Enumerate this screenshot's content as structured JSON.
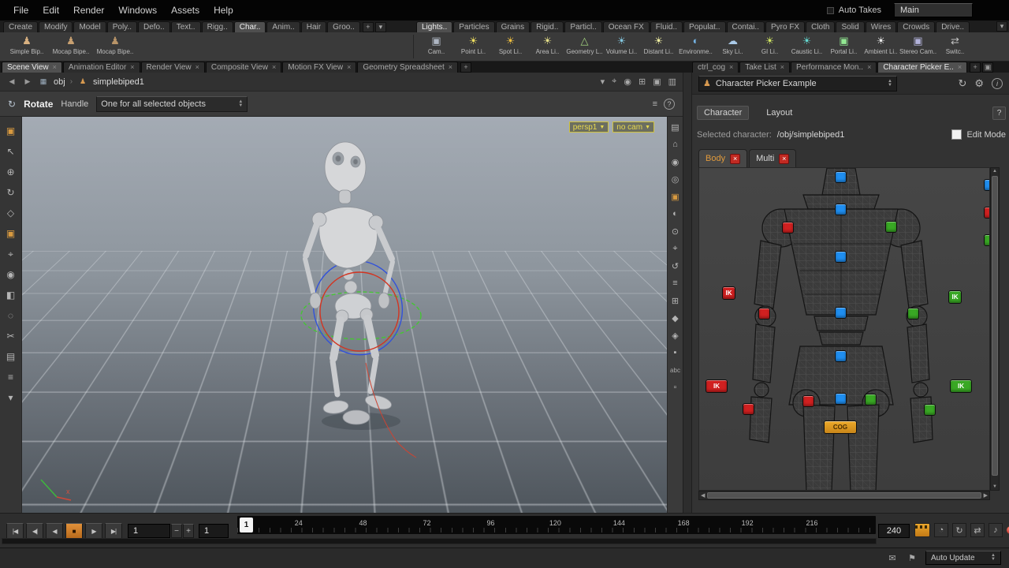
{
  "menubar": {
    "items": [
      "File",
      "Edit",
      "Render",
      "Windows",
      "Assets",
      "Help"
    ],
    "auto_takes": "Auto Takes",
    "take": "Main"
  },
  "shelf": {
    "tabs_left": [
      "Create",
      "Modify",
      "Model",
      "Poly..",
      "Defo..",
      "Text..",
      "Rigg..",
      "Char..",
      "Anim..",
      "Hair",
      "Groo.."
    ],
    "tabs_right": [
      "Lights..",
      "Particles",
      "Grains",
      "Rigid..",
      "Particl..",
      "Ocean FX",
      "Fluid..",
      "Populat..",
      "Contai..",
      "Pyro FX",
      "Cloth",
      "Solid",
      "Wires",
      "Crowds",
      "Drive.."
    ],
    "tools_left": [
      "Simple Bip..",
      "Mocap Bipe..",
      "Mocap Bipe.."
    ],
    "tools_right": [
      "Cam..",
      "Point Li..",
      "Spot Li..",
      "Area Li..",
      "Geometry L..",
      "Volume Li..",
      "Distant Li..",
      "Environme..",
      "Sky Li..",
      "GI Li..",
      "Caustic Li..",
      "Portal Li..",
      "Ambient Li..",
      "Stereo Cam..",
      "Switc.."
    ]
  },
  "pane_tabs": {
    "left": [
      "Scene View",
      "Animation Editor",
      "Render View",
      "Composite View",
      "Motion FX View",
      "Geometry Spreadsheet"
    ],
    "right": [
      "ctrl_cog",
      "Take List",
      "Performance Mon..",
      "Character Picker E.."
    ]
  },
  "pathbar": {
    "context": "obj",
    "node": "simplebiped1"
  },
  "viewport": {
    "mode": "Rotate",
    "handle": "Handle",
    "selector": "One for all selected objects",
    "camera": "persp1",
    "cam_menu": "no cam"
  },
  "picker": {
    "title": "Character Picker Example",
    "tab1": "Character",
    "tab2": "Layout",
    "selected_label": "Selected character:",
    "selected_value": "/obj/simplebiped1",
    "edit_mode": "Edit Mode",
    "body_tab": "Body",
    "multi_tab": "Multi",
    "ik": "IK",
    "cog": "COG"
  },
  "timeline": {
    "current": "1",
    "labels": [
      "24",
      "48",
      "72",
      "96",
      "120",
      "144",
      "168",
      "192",
      "216"
    ],
    "frame": "1",
    "frame2": "1",
    "end": "240"
  },
  "statusbar": {
    "auto_update": "Auto Update"
  }
}
